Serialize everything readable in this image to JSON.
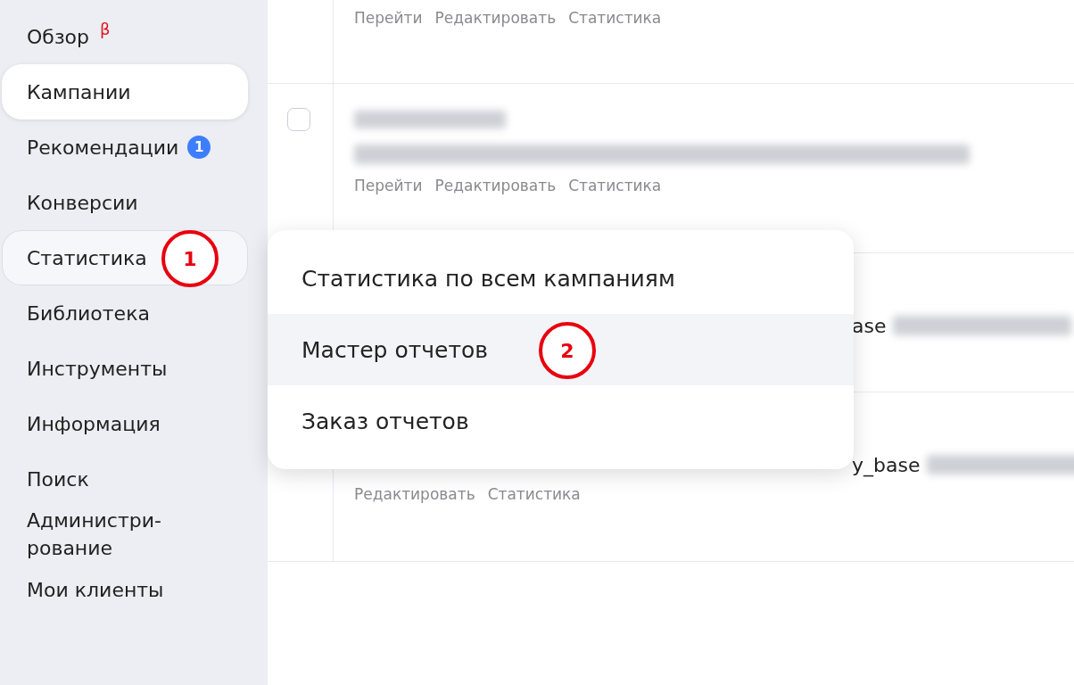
{
  "sidebar": {
    "items": [
      {
        "label": "Обзор",
        "selected": false,
        "hovered": false,
        "beta": "β"
      },
      {
        "label": "Кампании",
        "selected": true,
        "hovered": false
      },
      {
        "label": "Рекомендации",
        "selected": false,
        "hovered": false,
        "badge": "1"
      },
      {
        "label": "Конверсии",
        "selected": false,
        "hovered": false
      },
      {
        "label": "Статистика",
        "selected": false,
        "hovered": true
      },
      {
        "label": "Библиотека",
        "selected": false,
        "hovered": false
      },
      {
        "label": "Инструменты",
        "selected": false,
        "hovered": false
      },
      {
        "label": "Информация",
        "selected": false,
        "hovered": false
      },
      {
        "label": "Поиск",
        "selected": false,
        "hovered": false
      },
      {
        "label": "Администри-рование",
        "selected": false,
        "hovered": false
      },
      {
        "label": "Мои клиенты",
        "selected": false,
        "hovered": false
      }
    ]
  },
  "campaigns": {
    "rows": [
      {
        "kind": "top",
        "links": [
          "Перейти",
          "Редактировать",
          "Статистика"
        ]
      },
      {
        "kind": "full",
        "checkbox": {
          "checked": false
        },
        "blurred": [
          {
            "kind": "short"
          },
          {
            "kind": "long"
          }
        ],
        "links": [
          "Перейти",
          "Редактировать",
          "Статистика"
        ]
      },
      {
        "kind": "covered",
        "fragment": "ase"
      },
      {
        "kind": "covered-links",
        "fragment": "y_base",
        "links": [
          "Редактировать",
          "Статистика"
        ]
      }
    ]
  },
  "menu": {
    "items": [
      {
        "label": "Статистика по всем кампаниям",
        "hovered": false
      },
      {
        "label": "Мастер отчетов",
        "hovered": true
      },
      {
        "label": "Заказ отчетов",
        "hovered": false
      }
    ]
  },
  "annotations": [
    {
      "label": "1"
    },
    {
      "label": "2"
    }
  ]
}
